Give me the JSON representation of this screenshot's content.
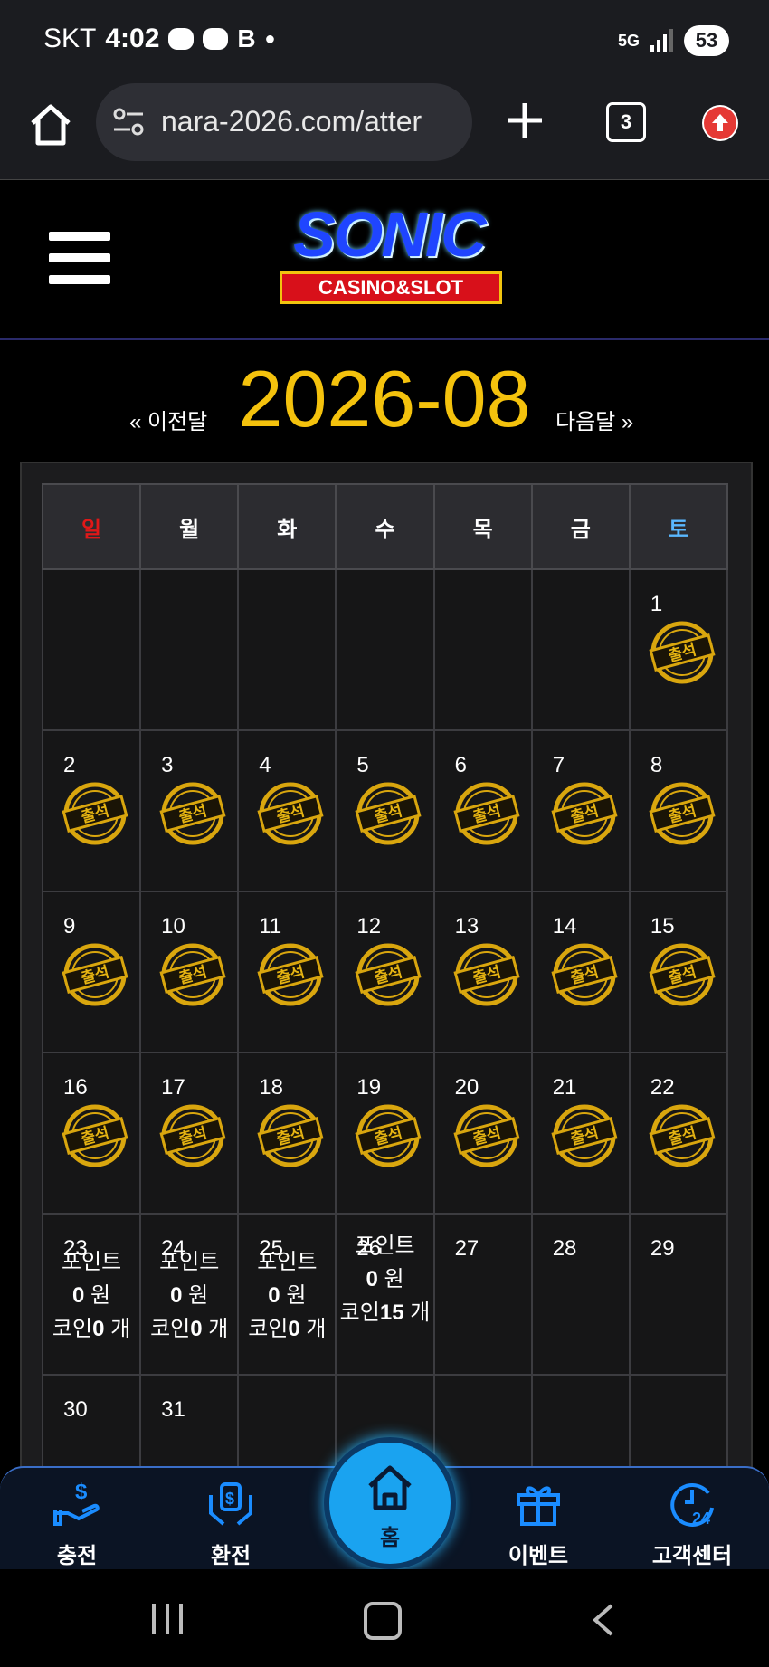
{
  "status_bar": {
    "carrier": "SKT",
    "time": "4:02",
    "network": "5G",
    "battery": "53"
  },
  "browser": {
    "url": "nara-2026.com/atter",
    "tab_count": "3"
  },
  "site": {
    "logo_main": "SONIC",
    "logo_sub": "CASINO&SLOT"
  },
  "month_nav": {
    "prev": "« 이전달",
    "title": "2026-08",
    "next": "다음달 »"
  },
  "calendar": {
    "weekdays": [
      "일",
      "월",
      "화",
      "수",
      "목",
      "금",
      "토"
    ],
    "stamp_label": "출석",
    "weeks": [
      [
        {
          "day": ""
        },
        {
          "day": ""
        },
        {
          "day": ""
        },
        {
          "day": ""
        },
        {
          "day": ""
        },
        {
          "day": ""
        },
        {
          "day": "1",
          "stamp": true
        }
      ],
      [
        {
          "day": "2",
          "stamp": true
        },
        {
          "day": "3",
          "stamp": true
        },
        {
          "day": "4",
          "stamp": true
        },
        {
          "day": "5",
          "stamp": true
        },
        {
          "day": "6",
          "stamp": true
        },
        {
          "day": "7",
          "stamp": true
        },
        {
          "day": "8",
          "stamp": true
        }
      ],
      [
        {
          "day": "9",
          "stamp": true
        },
        {
          "day": "10",
          "stamp": true
        },
        {
          "day": "11",
          "stamp": true
        },
        {
          "day": "12",
          "stamp": true
        },
        {
          "day": "13",
          "stamp": true
        },
        {
          "day": "14",
          "stamp": true
        },
        {
          "day": "15",
          "stamp": true
        }
      ],
      [
        {
          "day": "16",
          "stamp": true
        },
        {
          "day": "17",
          "stamp": true
        },
        {
          "day": "18",
          "stamp": true
        },
        {
          "day": "19",
          "stamp": true
        },
        {
          "day": "20",
          "stamp": true
        },
        {
          "day": "21",
          "stamp": true
        },
        {
          "day": "22",
          "stamp": true
        }
      ],
      [
        {
          "day": "23",
          "info": {
            "point_label": "포인트",
            "point_value": "0",
            "point_unit": " 원",
            "coin_label": "코인",
            "coin_value": "0",
            "coin_unit": " 개"
          }
        },
        {
          "day": "24",
          "info": {
            "point_label": "포인트",
            "point_value": "0",
            "point_unit": " 원",
            "coin_label": "코인",
            "coin_value": "0",
            "coin_unit": " 개"
          }
        },
        {
          "day": "25",
          "info": {
            "point_label": "포인트",
            "point_value": "0",
            "point_unit": " 원",
            "coin_label": "코인",
            "coin_value": "0",
            "coin_unit": " 개"
          }
        },
        {
          "day": "26",
          "info": {
            "point_label": "포인트",
            "point_value": "0",
            "point_unit": " 원",
            "coin_label": "코인",
            "coin_value": "15",
            "coin_unit": " 개"
          }
        },
        {
          "day": "27"
        },
        {
          "day": "28"
        },
        {
          "day": "29"
        }
      ],
      [
        {
          "day": "30"
        },
        {
          "day": "31"
        },
        {
          "day": ""
        },
        {
          "day": ""
        },
        {
          "day": ""
        },
        {
          "day": ""
        },
        {
          "day": ""
        }
      ]
    ]
  },
  "bottom_nav": {
    "deposit": "충전",
    "withdraw": "환전",
    "home": "홈",
    "event": "이벤트",
    "support": "고객센터"
  },
  "colors": {
    "accent": "#f4c20d",
    "sunday": "#e01818",
    "saturday": "#5ab8ff",
    "home_button": "#1aa3f0",
    "icon_blue": "#1a8cff"
  }
}
